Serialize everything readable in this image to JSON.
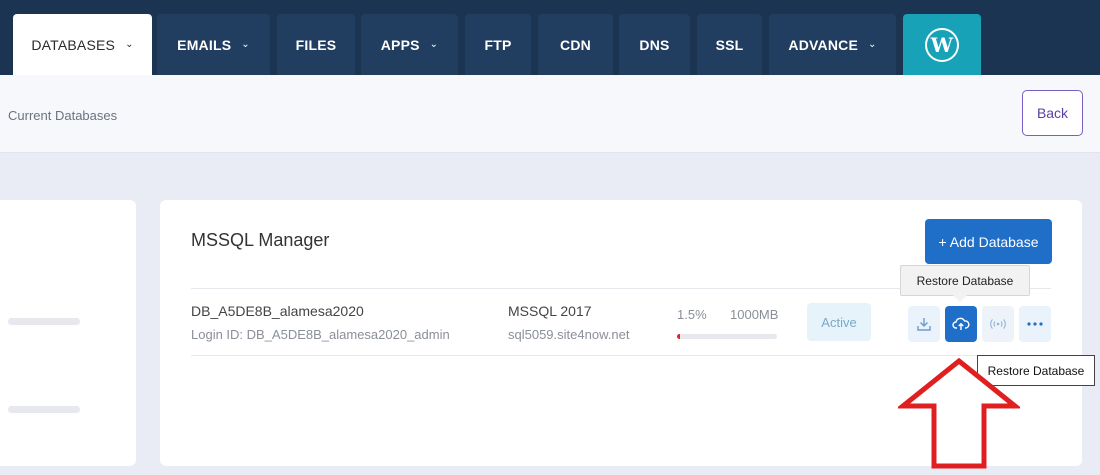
{
  "nav": {
    "tabs": [
      {
        "label": "DATABASES",
        "chevron": true,
        "active": true
      },
      {
        "label": "EMAILS",
        "chevron": true
      },
      {
        "label": "FILES",
        "chevron": false
      },
      {
        "label": "APPS",
        "chevron": true
      },
      {
        "label": "FTP",
        "chevron": false
      },
      {
        "label": "CDN",
        "chevron": false
      },
      {
        "label": "DNS",
        "chevron": false
      },
      {
        "label": "SSL",
        "chevron": false
      },
      {
        "label": "ADVANCE",
        "chevron": true
      }
    ],
    "wordpress_icon": "wordpress-icon"
  },
  "subheader": {
    "breadcrumb": "Current Databases",
    "back_label": "Back"
  },
  "manager": {
    "title": "MSSQL Manager",
    "add_label": "+ Add Database",
    "database": {
      "name": "DB_A5DE8B_alamesa2020",
      "login": "Login ID: DB_A5DE8B_alamesa2020_admin",
      "type": "MSSQL 2017",
      "host": "sql5059.site4now.net",
      "usage_percent": "1.5%",
      "usage_size": "1000MB",
      "usage_fraction": 0.015,
      "status": "Active"
    },
    "actions": {
      "download_icon": "download-icon",
      "restore_icon": "cloud-restore-icon",
      "share_icon": "broadcast-icon",
      "more_icon": "more-icon"
    }
  },
  "tooltips": {
    "restore_top": "Restore Database",
    "restore_side": "Restore Database"
  },
  "colors": {
    "nav_bg": "#1b3452",
    "primary": "#1f6fc9",
    "wordpress": "#17a2b8",
    "arrow": "#e02020",
    "progress": "#e02424"
  }
}
